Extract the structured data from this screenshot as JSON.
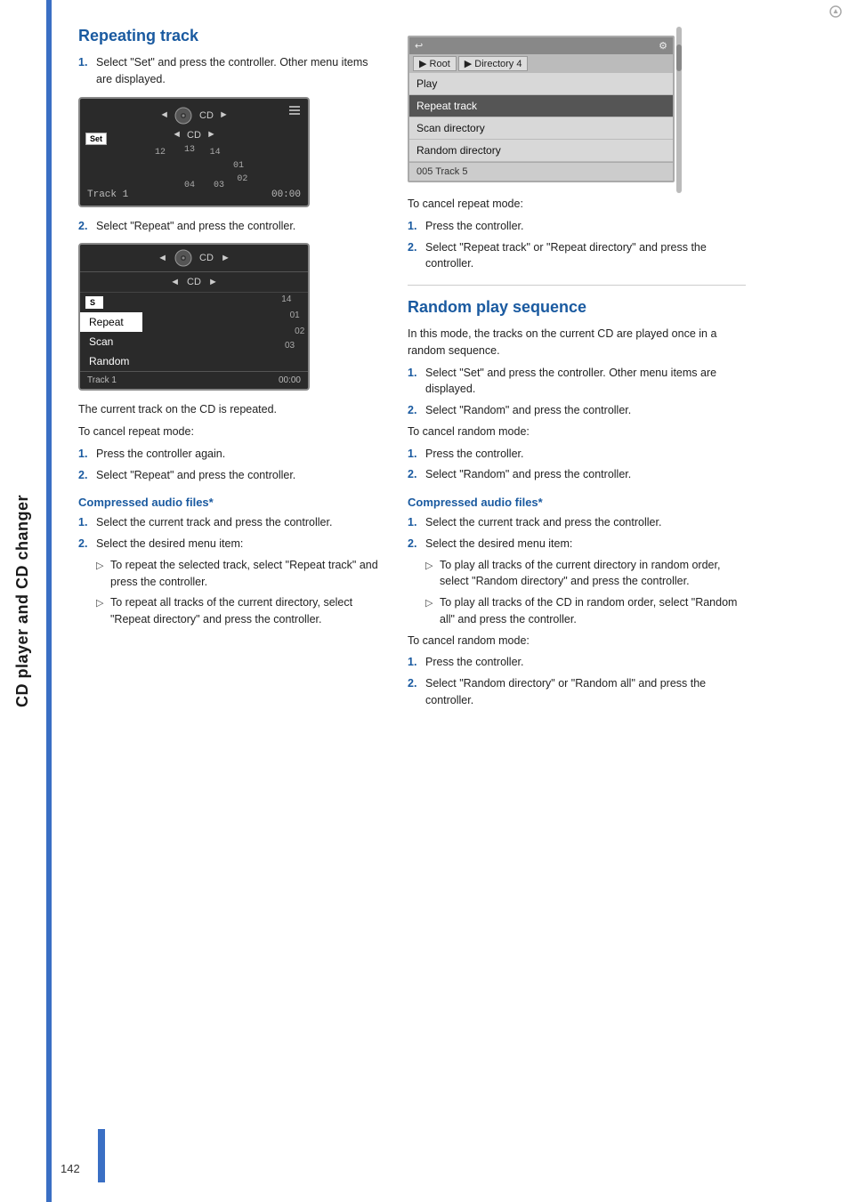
{
  "sidebar": {
    "label": "CD player and CD changer"
  },
  "left_column": {
    "section_title": "Repeating track",
    "step1": "Select \"Set\" and press the controller. Other menu items are displayed.",
    "step2": "Select \"Repeat\" and press the controller.",
    "note1": "The current track on the CD is repeated.",
    "cancel_header": "To cancel repeat mode:",
    "cancel1": "Press the controller again.",
    "cancel2": "Select \"Repeat\" and press the controller.",
    "sub_title": "Compressed audio files*",
    "sub_step1": "Select the current track and press the controller.",
    "sub_step2": "Select the desired menu item:",
    "bullet1": "To repeat the selected track, select \"Repeat track\" and press the controller.",
    "bullet2": "To repeat all tracks of the current directory, select \"Repeat directory\" and press the controller.",
    "screen1": {
      "cd_label": "CD",
      "set_label": "Set",
      "track_label": "Track 1",
      "time": "00:00",
      "nums": [
        "12",
        "13",
        "14",
        "01",
        "02",
        "03",
        "04"
      ]
    },
    "screen2": {
      "cd_label": "CD",
      "s_label": "S",
      "menu_items": [
        "Repeat",
        "Scan",
        "Random"
      ],
      "track_nums": [
        "14",
        "01",
        "02",
        "03"
      ],
      "track_label": "Track 1",
      "time": "00:00"
    }
  },
  "right_column": {
    "section_title": "Random play sequence",
    "intro": "In this mode, the tracks on the current CD are played once in a random sequence.",
    "step1": "Select \"Set\" and press the controller. Other menu items are displayed.",
    "step2": "Select \"Random\" and press the controller.",
    "cancel_header": "To cancel random mode:",
    "cancel1": "Press the controller.",
    "cancel2": "Select \"Random\" and press the controller.",
    "sub_title": "Compressed audio files*",
    "sub_step1": "Select the current track and press the controller.",
    "sub_step2": "Select the desired menu item:",
    "bullet1": "To play all tracks of the current directory in random order, select \"Random directory\" and press the controller.",
    "bullet2": "To play all tracks of the CD in random order, select \"Random all\" and press the controller.",
    "cancel2_header": "To cancel random mode:",
    "cancel2_1": "Press the controller.",
    "cancel2_2": "Select \"Random directory\" or \"Random all\" and press the controller.",
    "screen": {
      "back_icon": "↩",
      "settings_icon": "⚙",
      "breadcrumb": [
        "▶ Root",
        "▶ Directory 4"
      ],
      "menu_items": [
        "Play",
        "Repeat track",
        "Scan directory",
        "Random directory"
      ],
      "footer": "005 Track 5",
      "cancel_note": "To cancel repeat mode:",
      "cancel_note1": "Press the controller.",
      "cancel_note2": "Select \"Repeat track\" or \"Repeat directory\" and press the controller."
    }
  },
  "page_number": "142"
}
